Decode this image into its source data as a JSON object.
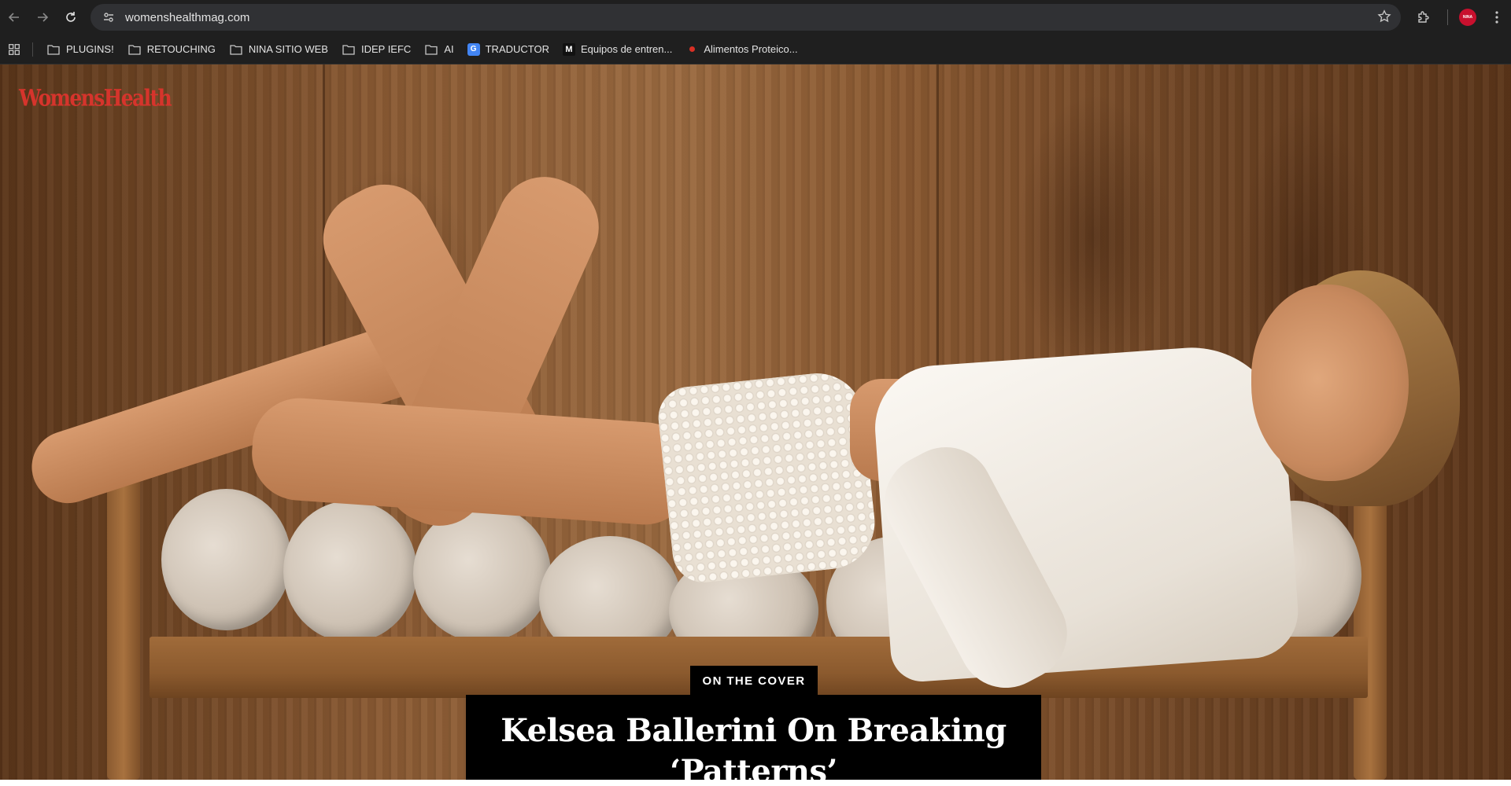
{
  "browser": {
    "url": "womenshealthmag.com",
    "profile_avatar_text": "NINA",
    "profile_color": "#c8102e",
    "icons": [
      "back-icon",
      "forward-icon",
      "reload-icon",
      "site-info-icon",
      "bookmark-star-icon",
      "extensions-icon",
      "kebab-menu-icon",
      "apps-grid-icon"
    ]
  },
  "bookmarks": {
    "items": [
      {
        "label": "PLUGINS!",
        "icon": "folder-icon"
      },
      {
        "label": "RETOUCHING",
        "icon": "folder-icon"
      },
      {
        "label": "NINA SITIO WEB",
        "icon": "folder-icon"
      },
      {
        "label": "IDEP IEFC",
        "icon": "folder-icon"
      },
      {
        "label": "AI",
        "icon": "folder-icon"
      },
      {
        "label": "TRADUCTOR",
        "icon": "google-translate-icon"
      },
      {
        "label": "Equipos de entren...",
        "icon": "m-logo-icon"
      },
      {
        "label": "Alimentos Proteico...",
        "icon": "red-dot-icon"
      }
    ]
  },
  "page": {
    "logo_text": "WomensHealth",
    "logo_color": "#d6342c",
    "cover_tag": "ON THE COVER",
    "headline": "Kelsea Ballerini On Breaking ‘Patterns’"
  }
}
